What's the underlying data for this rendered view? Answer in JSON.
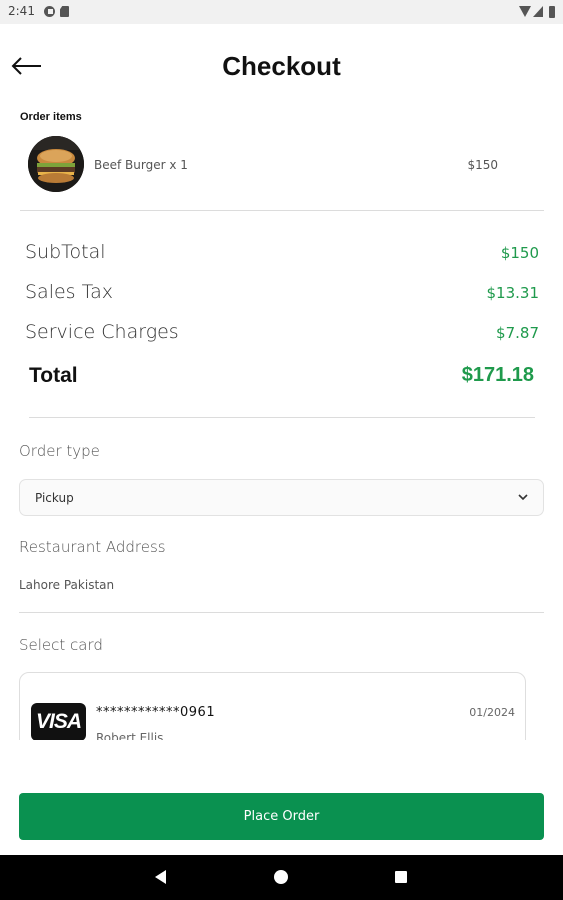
{
  "status_bar": {
    "time": "2:41"
  },
  "header": {
    "title": "Checkout"
  },
  "order": {
    "section_label": "Order items",
    "items": [
      {
        "name": "Beef Burger x 1",
        "price": "$150"
      }
    ]
  },
  "summary": {
    "subtotal_label": "SubTotal",
    "subtotal_value": "$150",
    "tax_label": "Sales Tax",
    "tax_value": "$13.31",
    "service_label": "Service Charges",
    "service_value": "$7.87",
    "total_label": "Total",
    "total_value": "$171.18"
  },
  "order_type": {
    "label": "Order type",
    "selected": "Pickup"
  },
  "restaurant": {
    "label": "Restaurant Address",
    "address": "Lahore Pakistan"
  },
  "card": {
    "label": "Select card",
    "brand": "VISA",
    "number": "************0961",
    "expiry": "01/2024",
    "holder": "Robert Ellis"
  },
  "actions": {
    "place_order": "Place Order"
  },
  "colors": {
    "accent": "#0a9150",
    "price_green": "#1f9a4c"
  }
}
